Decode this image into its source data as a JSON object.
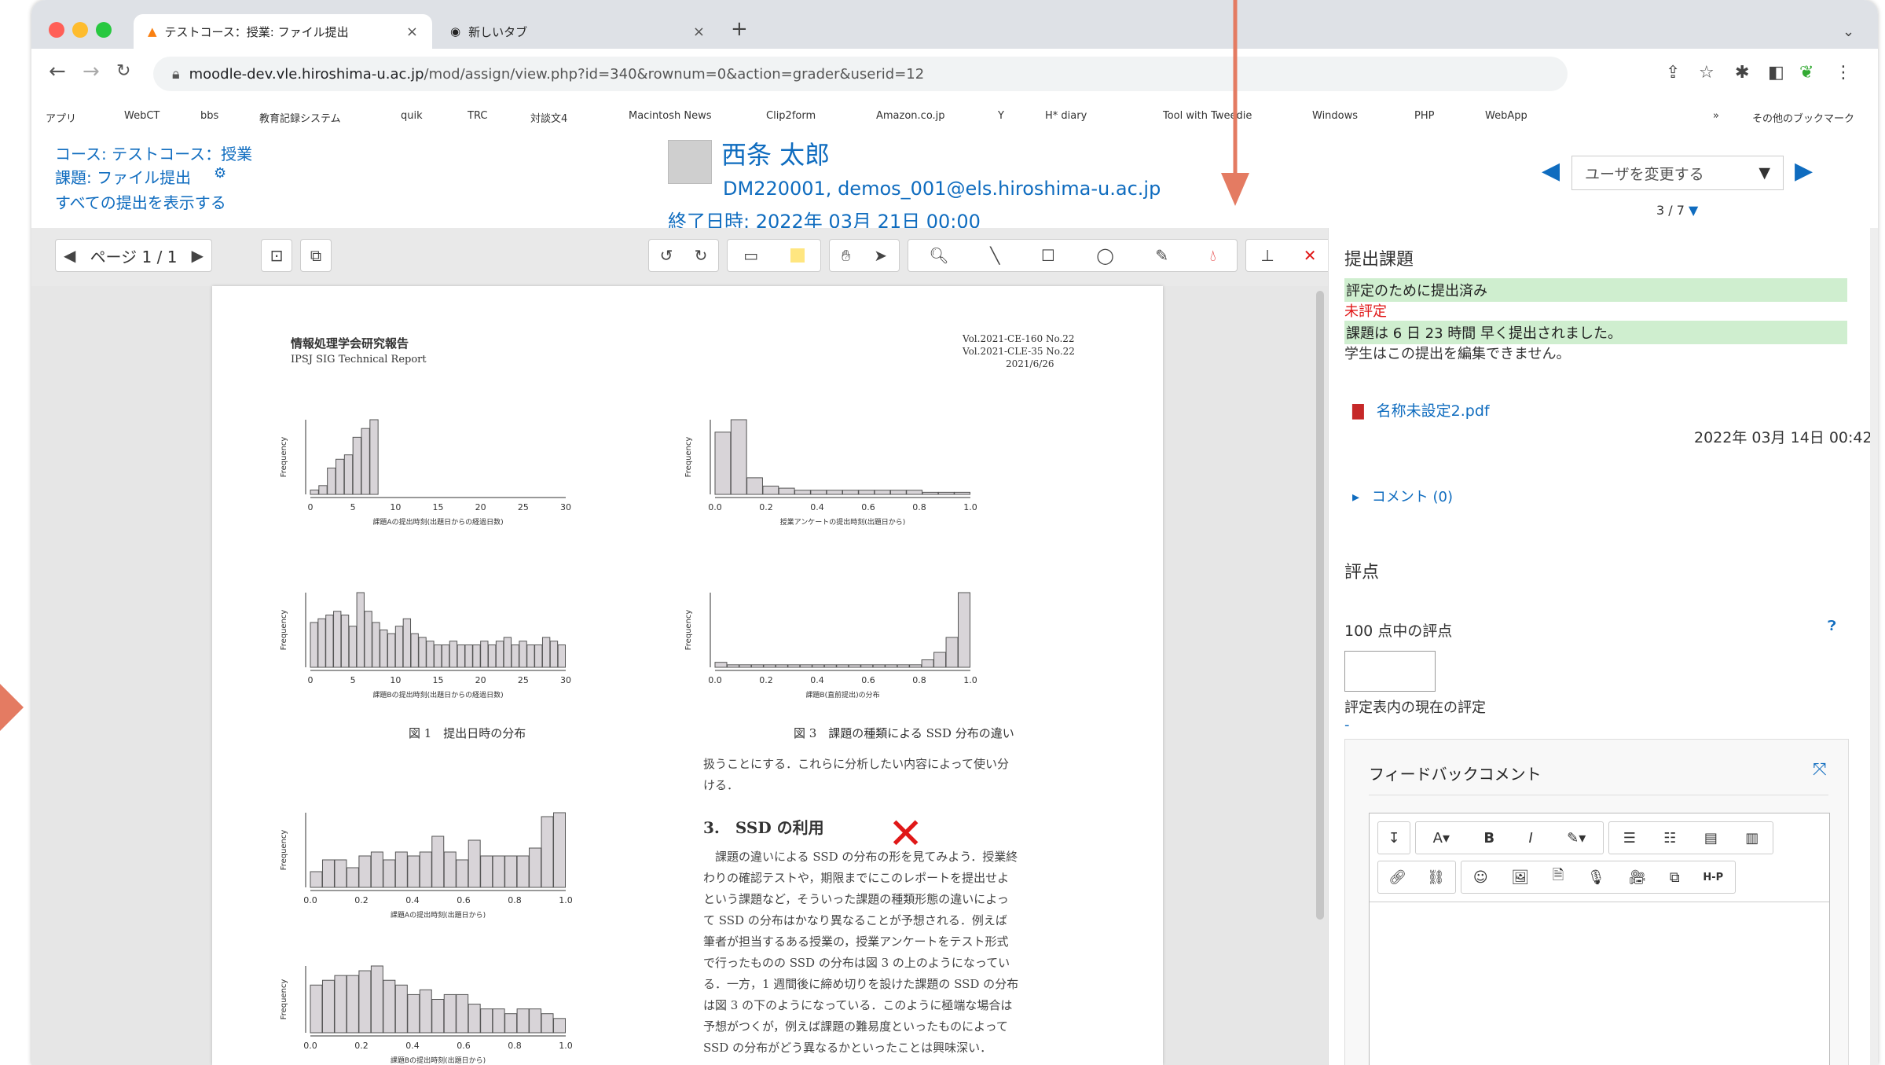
{
  "browser": {
    "tabs": [
      {
        "label": "テストコース：授業: ファイル提出",
        "active": true
      },
      {
        "label": "新しいタブ",
        "active": false
      }
    ],
    "url_host": "moodle-dev.vle.hiroshima-u.ac.jp",
    "url_path": "/mod/assign/view.php?id=340&rownum=0&action=grader&userid=12",
    "bookmarks": [
      "アプリ",
      "WebCT",
      "bbs",
      "教育記録システム",
      "quik",
      "TRC",
      "対談文4",
      "Macintosh News",
      "Clip2form",
      "Amazon.co.jp",
      "Y",
      "H* diary",
      "Tool with Tweedie",
      "Windows",
      "PHP",
      "WebApp",
      "»",
      "その他のブックマーク"
    ]
  },
  "header": {
    "course_link": "コース: テストコース：授業",
    "assignment_link": "課題: ファイル提出",
    "view_all_link": "すべての提出を表示する",
    "user_name": "西条 太郎",
    "user_info": "DM220001, demos_001@els.hiroshima-u.ac.jp",
    "due_date": "終了日時: 2022年 03月 21日 00:00",
    "change_user_placeholder": "ユーザを変更する",
    "user_count": "3 / 7"
  },
  "toolbar": {
    "page_label": "ページ 1 / 1"
  },
  "document": {
    "header_title": "情報処理学会研究報告",
    "header_sub": "IPSJ SIG Technical Report",
    "header_right_1": "Vol.2021-CE-160 No.22",
    "header_right_2": "Vol.2021-CLE-35 No.22",
    "header_right_3": "2021/6/26",
    "fig1_caption": "図 1　提出日時の分布",
    "fig3_caption": "図 3　課題の種類による SSD 分布の違い",
    "intro_text_1": "扱うことにする．これらに分析したい内容によって使い分",
    "intro_text_2": "ける．",
    "section_title": "3.　SSD の利用",
    "body_lines": [
      "　課題の違いによる SSD の分布の形を見てみよう．授業終",
      "わりの確認テストや，期限までにこのレポートを提出せよ",
      "という課題など，そういった課題の種類形態の違いによっ",
      "て SSD の分布はかなり異なることが予想される．例えば",
      "筆者が担当するある授業の，授業アンケートをテスト形式",
      "で行ったものの SSD の分布は図 3 の上のようになってい",
      "る．一方，1 週間後に締め切りを設けた課題の SSD の分布",
      "は図 3 の下のようになっている．このように極端な場合は",
      "予想がつくが，例えば課題の難易度といったものによって",
      "SSD の分布がどう異なるかといったことは興味深い．"
    ]
  },
  "panel": {
    "submission_title": "提出課題",
    "status_submitted": "評定のために提出済み",
    "status_ungraded": "未評定",
    "status_early": "課題は 6 日 23 時間 早く提出されました。",
    "status_locked": "学生はこの提出を編集できません。",
    "file_name": "名称未設定2.pdf",
    "file_date": "2022年 03月 14日 00:42",
    "comments": "コメント (0)",
    "grade_title": "評点",
    "grade_label": "100 点中の評点",
    "current_grade_label": "評定表内の現在の評定",
    "current_grade_value": "-",
    "feedback_title": "フィードバックコメント"
  },
  "colors": {
    "link": "#0f6cbf",
    "status_green": "#cfeecf",
    "status_red": "#e01818",
    "annotation_arrow": "#e47b62"
  },
  "chart_data": [
    {
      "type": "bar",
      "title": "",
      "ylabel": "Frequency",
      "xlabel": "課題Aの提出時刻(出題日からの経過日数)",
      "x_ticks": [
        "0",
        "5",
        "10",
        "15",
        "20",
        "25",
        "30"
      ],
      "values": [
        20,
        40,
        120,
        160,
        180,
        260,
        300,
        340,
        0,
        0,
        0,
        0,
        0,
        0,
        0,
        0,
        0,
        0,
        0,
        0,
        0,
        0,
        0,
        0,
        0,
        0,
        0,
        0,
        0,
        0
      ]
    },
    {
      "type": "bar",
      "title": "",
      "ylabel": "Frequency",
      "xlabel": "授業アンケートの提出時刻(出題日から)",
      "x_ticks": [
        "0.0",
        "0.2",
        "0.4",
        "0.6",
        "0.8",
        "1.0"
      ],
      "values": [
        30,
        36,
        8,
        4,
        3,
        2,
        2,
        2,
        2,
        2,
        2,
        2,
        2,
        1,
        1,
        1
      ]
    },
    {
      "type": "bar",
      "title": "",
      "ylabel": "Frequency",
      "xlabel": "課題Bの提出時刻(出題日からの経過日数)",
      "x_ticks": [
        "0",
        "5",
        "10",
        "15",
        "20",
        "25",
        "30"
      ],
      "values": [
        120,
        130,
        140,
        150,
        140,
        110,
        200,
        150,
        120,
        100,
        90,
        110,
        130,
        90,
        80,
        70,
        60,
        60,
        70,
        60,
        60,
        60,
        70,
        60,
        70,
        80,
        60,
        70,
        60,
        60,
        80,
        70,
        60
      ]
    },
    {
      "type": "bar",
      "title": "",
      "ylabel": "Frequency",
      "xlabel": "課題B(直前提出)の分布",
      "x_ticks": [
        "0.0",
        "0.2",
        "0.4",
        "0.6",
        "0.8",
        "1.0"
      ],
      "values": [
        2,
        1,
        1,
        1,
        1,
        1,
        1,
        1,
        1,
        1,
        1,
        1,
        1,
        1,
        1,
        1,
        1,
        3,
        6,
        12,
        30
      ]
    },
    {
      "type": "bar",
      "title": "",
      "ylabel": "Frequency",
      "xlabel": "課題Aの提出時刻(出題日から)",
      "x_ticks": [
        "0.0",
        "0.2",
        "0.4",
        "0.6",
        "0.8",
        "1.0"
      ],
      "values": [
        4,
        7,
        7,
        5,
        8,
        9,
        7,
        9,
        8,
        9,
        13,
        9,
        7,
        12,
        8,
        8,
        8,
        8,
        10,
        18,
        19
      ]
    },
    {
      "type": "bar",
      "title": "",
      "ylabel": "Frequency",
      "xlabel": "課題Bの提出時刻(出題日から)",
      "x_ticks": [
        "0.0",
        "0.2",
        "0.4",
        "0.6",
        "0.8",
        "1.0"
      ],
      "values": [
        10,
        11,
        12,
        12,
        13,
        14,
        11,
        10,
        8,
        9,
        7,
        8,
        8,
        6,
        5,
        5,
        4,
        5,
        5,
        4,
        3
      ]
    }
  ]
}
